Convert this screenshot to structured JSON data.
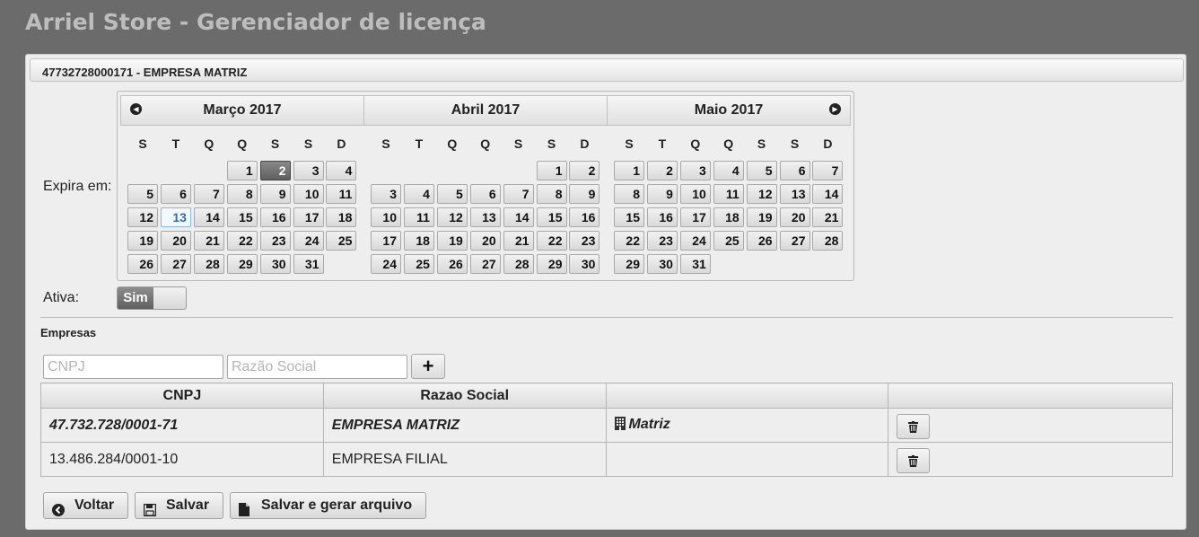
{
  "app": {
    "title": "Arriel Store - Gerenciador de licença"
  },
  "panel": {
    "header": "47732728000171 - EMPRESA MATRIZ"
  },
  "form": {
    "expira_label": "Expira em:",
    "ativa_label": "Ativa:",
    "ativa_value": "Sim"
  },
  "calendar": {
    "day_headers": [
      "S",
      "T",
      "Q",
      "Q",
      "S",
      "S",
      "D"
    ],
    "selected": "2 Março 2017",
    "today": "13 Março 2017",
    "months": [
      {
        "title": "Março 2017",
        "first_weekday": 3,
        "days": 31
      },
      {
        "title": "Abril 2017",
        "first_weekday": 5,
        "days": 30
      },
      {
        "title": "Maio 2017",
        "first_weekday": 0,
        "days": 31
      }
    ]
  },
  "empresas": {
    "title": "Empresas",
    "cnpj_placeholder": "CNPJ",
    "razao_placeholder": "Razão Social",
    "add_label": "+",
    "columns": [
      "CNPJ",
      "Razao Social",
      "",
      ""
    ],
    "rows": [
      {
        "cnpj": "47.732.728/0001-71",
        "razao": "EMPRESA MATRIZ",
        "tipo": "Matriz"
      },
      {
        "cnpj": "13.486.284/0001-10",
        "razao": "EMPRESA FILIAL",
        "tipo": ""
      }
    ]
  },
  "actions": {
    "voltar": "Voltar",
    "salvar": "Salvar",
    "salvar_gerar": "Salvar e gerar arquivo"
  },
  "icons": {
    "prev": "chevron-left-circle-icon",
    "next": "chevron-right-circle-icon",
    "building": "building-icon",
    "trash": "trash-icon",
    "back": "arrow-left-circle-icon",
    "save": "floppy-disk-icon",
    "file": "file-icon"
  }
}
